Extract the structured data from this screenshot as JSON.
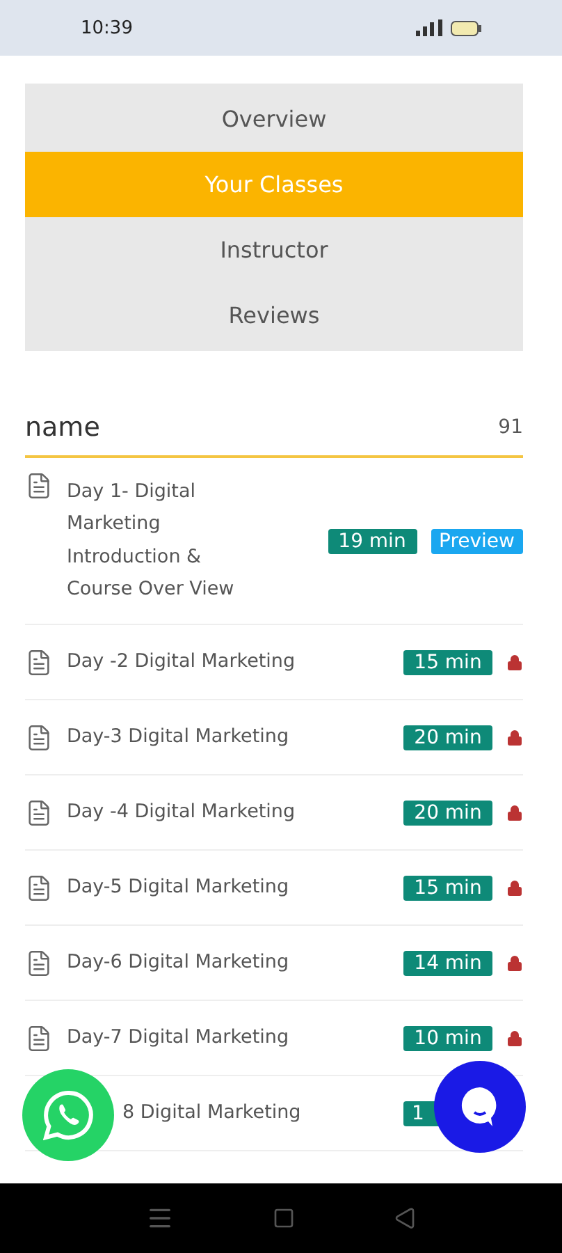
{
  "status_bar": {
    "time": "10:39"
  },
  "tabs": [
    {
      "label": "Overview",
      "selected": false
    },
    {
      "label": "Your Classes",
      "selected": true
    },
    {
      "label": "Instructor",
      "selected": false
    },
    {
      "label": "Reviews",
      "selected": false
    }
  ],
  "list_header": {
    "title": "name",
    "count": "91"
  },
  "lessons": [
    {
      "title": "Day 1- Digital Marketing Introduction & Course Over View",
      "duration": "19 min",
      "preview": "Preview",
      "locked": false
    },
    {
      "title": "Day -2 Digital Marketing",
      "duration": "15 min",
      "locked": true
    },
    {
      "title": "Day-3 Digital Marketing",
      "duration": "20 min",
      "locked": true
    },
    {
      "title": "Day -4 Digital Marketing",
      "duration": "20 min",
      "locked": true
    },
    {
      "title": "Day-5 Digital Marketing",
      "duration": "15 min",
      "locked": true
    },
    {
      "title": "Day-6 Digital Marketing",
      "duration": "14 min",
      "locked": true
    },
    {
      "title": "Day-7 Digital Marketing",
      "duration": "10 min",
      "locked": true
    },
    {
      "title": "8 Digital Marketing",
      "duration": "1",
      "covered": true
    }
  ]
}
